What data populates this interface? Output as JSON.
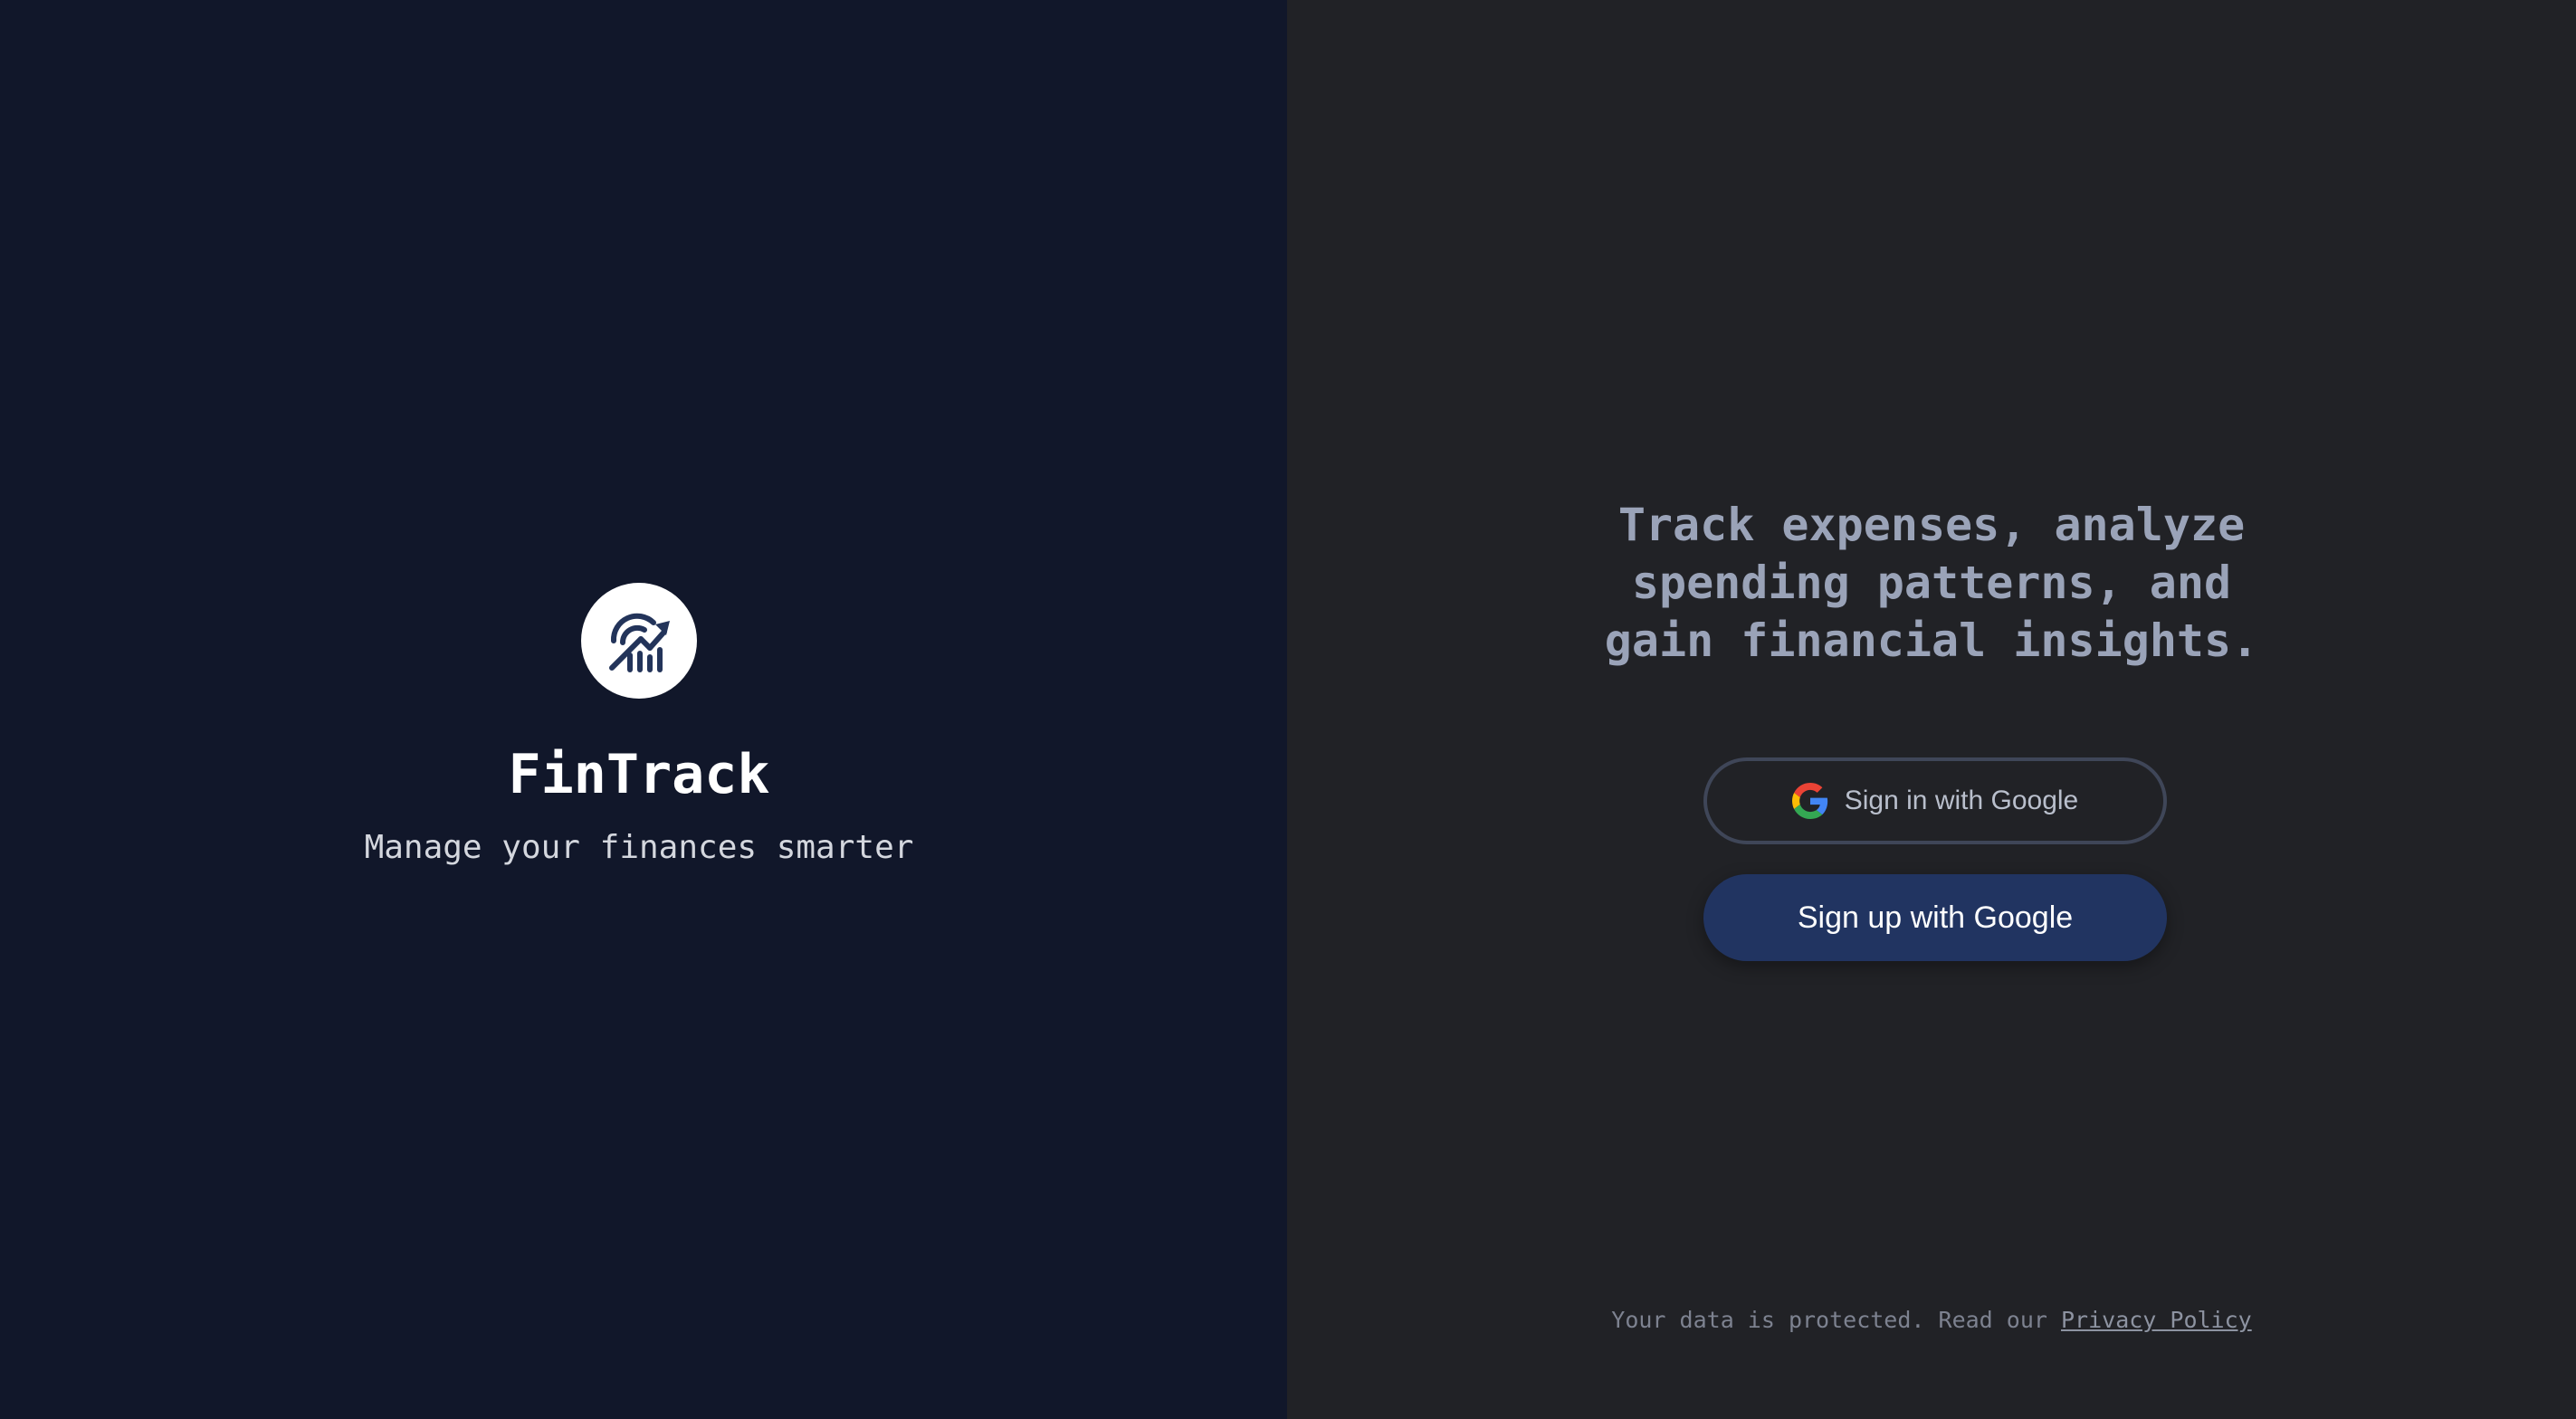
{
  "brand": {
    "logo_icon": "chart-growth-icon",
    "title": "FinTrack",
    "subtitle": "Manage your finances smarter"
  },
  "hero": {
    "tagline_lines": [
      "Track expenses, analyze",
      "spending patterns, and",
      "gain financial insights."
    ]
  },
  "auth": {
    "signin_icon": "google-icon",
    "signin_label": "Sign in with Google",
    "signup_label": "Sign up with Google"
  },
  "footer": {
    "text": "Your data is protected. Read our",
    "link_label": "Privacy Policy"
  },
  "colors": {
    "left_background": "#11172a",
    "right_background": "#212226",
    "accent_button": "#213461",
    "tagline": "#9aa3b8"
  }
}
